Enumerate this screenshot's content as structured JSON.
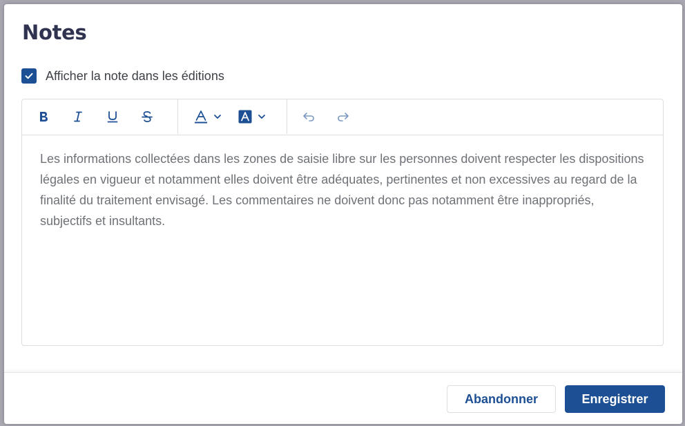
{
  "dialog": {
    "title": "Notes",
    "show_in_editions": {
      "label": "Afficher la note dans les éditions",
      "checked": true
    }
  },
  "toolbar": {
    "icons": [
      "bold-icon",
      "italic-icon",
      "underline-icon",
      "strikethrough-icon",
      "text-color-icon",
      "chevron-down-icon",
      "highlight-color-icon",
      "chevron-down-icon",
      "undo-icon",
      "redo-icon"
    ]
  },
  "editor": {
    "content": "Les informations collectées dans les zones de saisie libre sur les personnes doivent respecter les dispositions légales en vigueur et notamment elles doivent être adéquates, pertinentes et non excessives au regard de la finalité du traitement envisagé. Les commentaires ne doivent donc pas notamment être inappropriés, subjectifs et insultants."
  },
  "footer": {
    "cancel_label": "Abandonner",
    "save_label": "Enregistrer"
  },
  "colors": {
    "primary": "#1d4f94",
    "title": "#2f3350",
    "body_text": "#6e7277"
  }
}
